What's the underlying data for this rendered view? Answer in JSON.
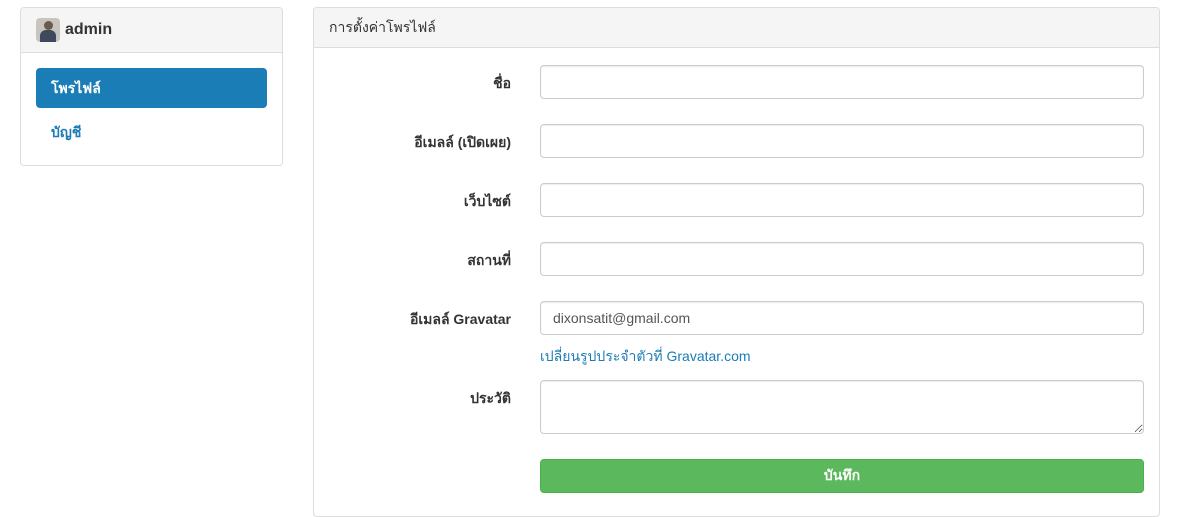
{
  "sidebar": {
    "user_name": "admin",
    "items": [
      {
        "label": "โพรไฟล์",
        "active": true
      },
      {
        "label": "บัญชี",
        "active": false
      }
    ]
  },
  "main": {
    "title": "การตั้งค่าโพรไฟล์",
    "fields": {
      "name": {
        "label": "ชื่อ",
        "value": ""
      },
      "public_email": {
        "label": "อีเมลล์ (เปิดเผย)",
        "value": ""
      },
      "website": {
        "label": "เว็บไซต์",
        "value": ""
      },
      "location": {
        "label": "สถานที่",
        "value": ""
      },
      "gravatar_email": {
        "label": "อีเมลล์ Gravatar",
        "value": "dixonsatit@gmail.com"
      },
      "bio": {
        "label": "ประวัติ",
        "value": ""
      }
    },
    "gravatar_link": "เปลี่ยนรูปประจำตัวที่ Gravatar.com",
    "save_label": "บันทึก"
  },
  "colors": {
    "accent": "#1a7db6",
    "link": "#1c7cb5",
    "success": "#5cb85c"
  }
}
